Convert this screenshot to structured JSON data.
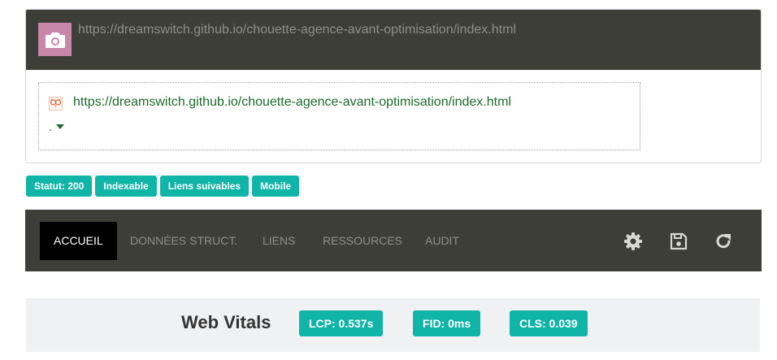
{
  "header": {
    "url": "https://dreamswitch.github.io/chouette-agence-avant-optimisation/index.html",
    "camera_icon": "camera-icon"
  },
  "page": {
    "url": "https://dreamswitch.github.io/chouette-agence-avant-optimisation/index.html",
    "favicon": "owl-favicon",
    "dot": "."
  },
  "badges": [
    {
      "label": "Statut: 200"
    },
    {
      "label": "Indexable"
    },
    {
      "label": "Liens suivables"
    },
    {
      "label": "Mobile"
    }
  ],
  "nav": {
    "tabs": [
      {
        "label": "ACCUEIL",
        "active": true
      },
      {
        "label": "DONNÉES STRUCT."
      },
      {
        "label": "LIENS"
      },
      {
        "label": "RESSOURCES"
      },
      {
        "label": "AUDIT"
      }
    ],
    "icons": [
      "gear-icon",
      "save-icon",
      "refresh-icon"
    ]
  },
  "vitals": {
    "title": "Web Vitals",
    "metrics": [
      {
        "label": "LCP:  0.537s"
      },
      {
        "label": "FID:  0ms"
      },
      {
        "label": "CLS:  0.039"
      }
    ]
  },
  "colors": {
    "dark": "#3e3e38",
    "accent": "#10b5a7",
    "link": "#1b6b2a",
    "camera_bg": "#c886a8"
  }
}
